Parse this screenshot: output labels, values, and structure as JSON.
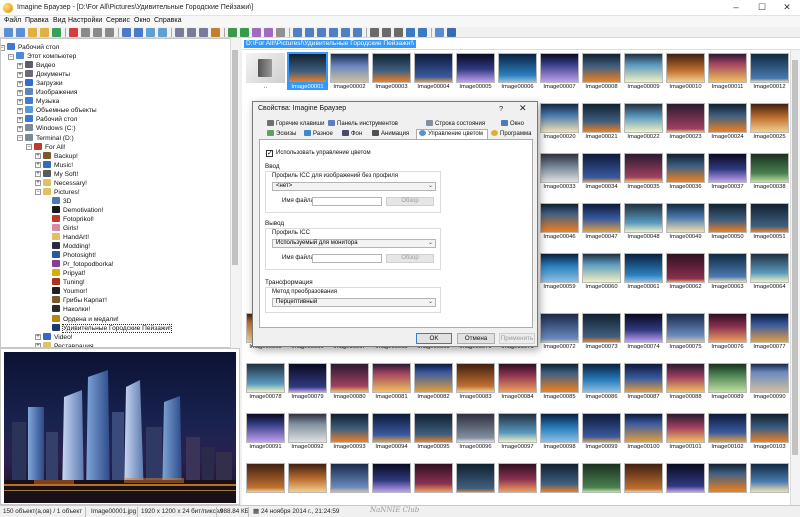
{
  "window": {
    "title": "Imagine Браузер - [D:\\For All\\Pictures\\Удивительные Городские Пейзажи\\]"
  },
  "menu": [
    "Файл",
    "Правка",
    "Вид",
    "Настройки",
    "Сервис",
    "Окно",
    "Справка"
  ],
  "tree": [
    {
      "label": "Рабочий стол",
      "depth": 0,
      "icon": "desktop-icon",
      "color": "#3a7bd5"
    },
    {
      "label": "Этот компьютер",
      "depth": 1,
      "icon": "computer-icon",
      "color": "#4a8ad8"
    },
    {
      "label": "Видео",
      "depth": 2,
      "icon": "video-folder-icon",
      "color": "#5c5c6e"
    },
    {
      "label": "Документы",
      "depth": 2,
      "icon": "documents-folder-icon",
      "color": "#6b6b7a"
    },
    {
      "label": "Загрузки",
      "depth": 2,
      "icon": "downloads-folder-icon",
      "color": "#2f6fd1"
    },
    {
      "label": "Изображения",
      "depth": 2,
      "icon": "pictures-folder-icon",
      "color": "#5f86b8"
    },
    {
      "label": "Музыка",
      "depth": 2,
      "icon": "music-folder-icon",
      "color": "#3e7dd0"
    },
    {
      "label": "Объемные объекты",
      "depth": 2,
      "icon": "3d-objects-folder-icon",
      "color": "#5a9ad6"
    },
    {
      "label": "Рабочий стол",
      "depth": 2,
      "icon": "desktop-folder-icon",
      "color": "#3a7bd5"
    },
    {
      "label": "Windows (C:)",
      "depth": 2,
      "icon": "drive-c-icon",
      "color": "#7a8a9a"
    },
    {
      "label": "Terminal (D:)",
      "depth": 2,
      "icon": "drive-d-icon",
      "color": "#7a8a9a"
    },
    {
      "label": "For All!",
      "depth": 3,
      "icon": "shared-folder-icon",
      "color": "#c0392b"
    },
    {
      "label": "Backup!",
      "depth": 4,
      "icon": "folder-icon",
      "color": "#7a5a2a"
    },
    {
      "label": "Music!",
      "depth": 4,
      "icon": "folder-icon",
      "color": "#2c6fbf"
    },
    {
      "label": "My Soft!",
      "depth": 4,
      "icon": "folder-icon",
      "color": "#5a5a5a"
    },
    {
      "label": "Necessary!",
      "depth": 4,
      "icon": "folder-icon",
      "color": "#e0c060"
    },
    {
      "label": "Pictures!",
      "depth": 4,
      "icon": "folder-icon",
      "color": "#e0c060"
    },
    {
      "label": "3D",
      "depth": 5,
      "icon": "folder-icon",
      "color": "#4a7ab0"
    },
    {
      "label": "Demotivation!",
      "depth": 5,
      "icon": "folder-icon",
      "color": "#1a1a1a"
    },
    {
      "label": "Fotoprikol!",
      "depth": 5,
      "icon": "folder-icon",
      "color": "#c0392b"
    },
    {
      "label": "Girls!",
      "depth": 5,
      "icon": "folder-icon",
      "color": "#d98aa0"
    },
    {
      "label": "HandArt!",
      "depth": 5,
      "icon": "folder-icon",
      "color": "#e0c060"
    },
    {
      "label": "Modding!",
      "depth": 5,
      "icon": "folder-icon",
      "color": "#2b2b40"
    },
    {
      "label": "Photosight!",
      "depth": 5,
      "icon": "folder-icon",
      "color": "#2a5a9a"
    },
    {
      "label": "Pr_fotopodborka!",
      "depth": 5,
      "icon": "folder-icon",
      "color": "#8a3a9a"
    },
    {
      "label": "Pripyat!",
      "depth": 5,
      "icon": "folder-icon",
      "color": "#d4b000"
    },
    {
      "label": "Tuning!",
      "depth": 5,
      "icon": "folder-icon",
      "color": "#b03020"
    },
    {
      "label": "Youmor!",
      "depth": 5,
      "icon": "folder-icon",
      "color": "#202020"
    },
    {
      "label": "Грибы Карпат!",
      "depth": 5,
      "icon": "folder-icon",
      "color": "#7a5a2a"
    },
    {
      "label": "Наколки!",
      "depth": 5,
      "icon": "folder-icon",
      "color": "#2a2a2a"
    },
    {
      "label": "Ордена и медали!",
      "depth": 5,
      "icon": "folder-icon",
      "color": "#b8860b"
    },
    {
      "label": "Удивительные Городские Пейзажи!",
      "depth": 5,
      "icon": "folder-icon",
      "color": "#1e3a6a",
      "selected": true
    },
    {
      "label": "Video!",
      "depth": 4,
      "icon": "folder-icon",
      "color": "#3a6ac0"
    },
    {
      "label": "Реставрация",
      "depth": 4,
      "icon": "folder-icon",
      "color": "#e0c060"
    }
  ],
  "path": "D:\\For All!\\Pictures!\\Удивительные Городские Пейзажи!\\",
  "thumbnails": {
    "parent_label": "..",
    "row1": [
      "Image00001",
      "Image00002",
      "Image00003",
      "Image00004",
      "Image00005",
      "Image00006",
      "Image00007",
      "Image00008",
      "Image00009",
      "Image00010",
      "Image00011",
      "Image00012"
    ],
    "right_rows": [
      [
        "Image00019",
        "Image00020",
        "Image00021",
        "Image00022",
        "Image00023",
        "Image00024",
        "Image00025"
      ],
      [
        "Image00032",
        "Image00033",
        "Image00034",
        "Image00035",
        "Image00036",
        "Image00037",
        "Image00038"
      ],
      [
        "Image00045",
        "Image00046",
        "Image00047",
        "Image00048",
        "Image00049",
        "Image00050",
        "Image00051"
      ],
      [
        "Image00058",
        "Image00059",
        "Image00060",
        "Image00061",
        "Image00062",
        "Image00063",
        "Image00064"
      ]
    ],
    "row6": [
      "Image00065",
      "Image00066",
      "Image00067",
      "Image00068",
      "Image00069",
      "Image00070",
      "Image00071",
      "Image00072",
      "Image00073",
      "Image00074",
      "Image00075",
      "Image00076",
      "Image00077"
    ],
    "row7": [
      "Image00078",
      "Image00079",
      "Image00080",
      "Image00081",
      "Image00082",
      "Image00083",
      "Image00084",
      "Image00085",
      "Image00086",
      "Image00087",
      "Image00088",
      "Image00089",
      "Image00090"
    ],
    "row8": [
      "Image00091",
      "Image00092",
      "Image00093",
      "Image00094",
      "Image00095",
      "Image00096",
      "Image00097",
      "Image00098",
      "Image00099",
      "Image00100",
      "Image00101",
      "Image00102",
      "Image00103"
    ]
  },
  "dialog": {
    "title": "Свойства: Imagine Браузер",
    "help": "?",
    "close": "✕",
    "tabs_row1": [
      "Горячие клавиши",
      "Панель инструментов",
      "Строка состояния",
      "Окно"
    ],
    "tabs_row2": [
      "Эскизы",
      "Разное",
      "Фон",
      "Анимация",
      "Управление цветом",
      "Программа"
    ],
    "use_color_mgmt": "Использовать управление цветом",
    "input_group": "Ввод",
    "icc_no_profile_label": "Профиль ICC для изображений без профиля",
    "icc_no_profile_value": "<нет>",
    "filename_label": "Имя файла",
    "browse": "Обзор",
    "output_group": "Вывод",
    "icc_profile_label": "Профиль ICC",
    "icc_profile_value": "Используемый для монитора",
    "filename_label2": "Имя файла",
    "browse2": "Обзор",
    "transform_group": "Трансформация",
    "transform_method_label": "Метод преобразования",
    "transform_method_value": "Перцептивный",
    "ok": "OK",
    "cancel": "Отмена",
    "apply": "Применить"
  },
  "status": {
    "objects": "150 объект(а,ов) / 1 объект",
    "filename": "Image00001.jpg",
    "dims": "1920 x 1200 x 24 бит/пиксел",
    "size": "988.84 КБ",
    "date": "24 ноября 2014 г., 21:24:59",
    "watermark": "NaNNIE Club"
  }
}
